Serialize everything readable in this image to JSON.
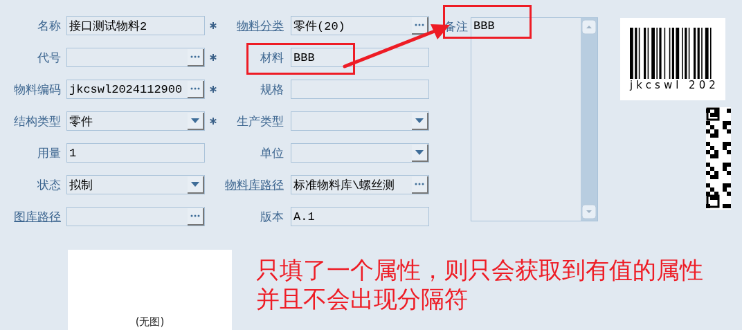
{
  "left_fields": [
    {
      "label": "名称",
      "value": "接口测试物料2",
      "kind": "text",
      "link": false,
      "required": true
    },
    {
      "label": "代号",
      "kind": "lookup",
      "link": false,
      "required": true
    },
    {
      "label": "物料编码",
      "value": "jkcswl2024112900",
      "kind": "lookup",
      "link": false,
      "required": true
    },
    {
      "label": "结构类型",
      "value": "零件",
      "kind": "select",
      "link": false,
      "required": true
    },
    {
      "label": "用量",
      "value": "1",
      "kind": "text",
      "link": false,
      "required": false
    },
    {
      "label": "状态",
      "value": "拟制",
      "kind": "select",
      "link": false,
      "required": false
    },
    {
      "label": "图库路径",
      "kind": "lookup",
      "link": true,
      "required": false
    }
  ],
  "middle_fields": [
    {
      "label": "物料分类",
      "value": "零件(20)",
      "kind": "lookup",
      "link": true
    },
    {
      "label": "材料",
      "value": "BBB",
      "kind": "text",
      "link": false
    },
    {
      "label": "规格",
      "kind": "text",
      "link": false
    },
    {
      "label": "生产类型",
      "kind": "select",
      "link": false
    },
    {
      "label": "单位",
      "kind": "select",
      "link": false
    },
    {
      "label": "物料库路径",
      "value": "标准物料库\\螺丝测",
      "kind": "lookup",
      "link": true
    },
    {
      "label": "版本",
      "value": "A.1",
      "kind": "text",
      "link": false
    }
  ],
  "remark": {
    "label": "备注",
    "value": "BBB"
  },
  "barcode": {
    "caption": "jkcswl 202"
  },
  "image_box": {
    "caption": "(无图)"
  },
  "annotation": {
    "lines": [
      "只填了一个属性，则只会获取到有值的属性",
      "并且不会出现分隔符"
    ]
  }
}
